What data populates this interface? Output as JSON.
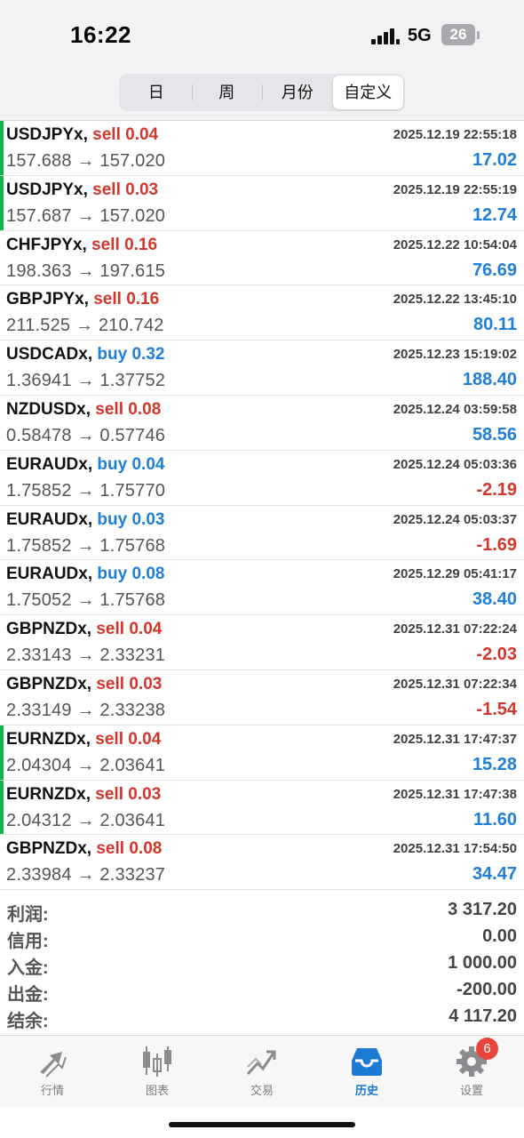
{
  "status_bar": {
    "time": "16:22",
    "network": "5G",
    "battery": "26"
  },
  "segments": [
    {
      "label": "日",
      "active": false
    },
    {
      "label": "周",
      "active": false
    },
    {
      "label": "月份",
      "active": false
    },
    {
      "label": "自定义",
      "active": true
    }
  ],
  "deals": [
    {
      "symbol": "USDJPYx,",
      "side": "sell",
      "volume": "0.04",
      "time": "2025.12.19 22:55:18",
      "price": "157.688 → 157.020",
      "profit": "17.02",
      "marked": true
    },
    {
      "symbol": "USDJPYx,",
      "side": "sell",
      "volume": "0.03",
      "time": "2025.12.19 22:55:19",
      "price": "157.687 → 157.020",
      "profit": "12.74",
      "marked": true
    },
    {
      "symbol": "CHFJPYx,",
      "side": "sell",
      "volume": "0.16",
      "time": "2025.12.22 10:54:04",
      "price": "198.363 → 197.615",
      "profit": "76.69",
      "marked": false
    },
    {
      "symbol": "GBPJPYx,",
      "side": "sell",
      "volume": "0.16",
      "time": "2025.12.22 13:45:10",
      "price": "211.525 → 210.742",
      "profit": "80.11",
      "marked": false
    },
    {
      "symbol": "USDCADx,",
      "side": "buy",
      "volume": "0.32",
      "time": "2025.12.23 15:19:02",
      "price": "1.36941 → 1.37752",
      "profit": "188.40",
      "marked": false
    },
    {
      "symbol": "NZDUSDx,",
      "side": "sell",
      "volume": "0.08",
      "time": "2025.12.24 03:59:58",
      "price": "0.58478 → 0.57746",
      "profit": "58.56",
      "marked": false
    },
    {
      "symbol": "EURAUDx,",
      "side": "buy",
      "volume": "0.04",
      "time": "2025.12.24 05:03:36",
      "price": "1.75852 → 1.75770",
      "profit": "-2.19",
      "marked": false
    },
    {
      "symbol": "EURAUDx,",
      "side": "buy",
      "volume": "0.03",
      "time": "2025.12.24 05:03:37",
      "price": "1.75852 → 1.75768",
      "profit": "-1.69",
      "marked": false
    },
    {
      "symbol": "EURAUDx,",
      "side": "buy",
      "volume": "0.08",
      "time": "2025.12.29 05:41:17",
      "price": "1.75052 → 1.75768",
      "profit": "38.40",
      "marked": false
    },
    {
      "symbol": "GBPNZDx,",
      "side": "sell",
      "volume": "0.04",
      "time": "2025.12.31 07:22:24",
      "price": "2.33143 → 2.33231",
      "profit": "-2.03",
      "marked": false
    },
    {
      "symbol": "GBPNZDx,",
      "side": "sell",
      "volume": "0.03",
      "time": "2025.12.31 07:22:34",
      "price": "2.33149 → 2.33238",
      "profit": "-1.54",
      "marked": false
    },
    {
      "symbol": "EURNZDx,",
      "side": "sell",
      "volume": "0.04",
      "time": "2025.12.31 17:47:37",
      "price": "2.04304 → 2.03641",
      "profit": "15.28",
      "marked": true
    },
    {
      "symbol": "EURNZDx,",
      "side": "sell",
      "volume": "0.03",
      "time": "2025.12.31 17:47:38",
      "price": "2.04312 → 2.03641",
      "profit": "11.60",
      "marked": true
    },
    {
      "symbol": "GBPNZDx,",
      "side": "sell",
      "volume": "0.08",
      "time": "2025.12.31 17:54:50",
      "price": "2.33984 → 2.33237",
      "profit": "34.47",
      "marked": false
    }
  ],
  "summary": [
    {
      "label": "利润:",
      "value": "3 317.20"
    },
    {
      "label": "信用:",
      "value": "0.00"
    },
    {
      "label": "入金:",
      "value": "1 000.00"
    },
    {
      "label": "出金:",
      "value": "-200.00"
    },
    {
      "label": "结余:",
      "value": "4 117.20"
    }
  ],
  "tabs": [
    {
      "label": "行情",
      "icon": "quotes-arrows-icon",
      "active": false
    },
    {
      "label": "图表",
      "icon": "candlestick-chart-icon",
      "active": false
    },
    {
      "label": "交易",
      "icon": "trade-line-icon",
      "active": false
    },
    {
      "label": "历史",
      "icon": "history-inbox-icon",
      "active": true
    },
    {
      "label": "设置",
      "icon": "settings-gear-icon",
      "active": false,
      "badge": "6"
    }
  ],
  "colors": {
    "sell": "#d2362b",
    "buy": "#1f7fd6",
    "positive": "#1f7fd6",
    "negative": "#d2362b",
    "marker": "#16b24a",
    "active_tab": "#1a7ad4"
  }
}
